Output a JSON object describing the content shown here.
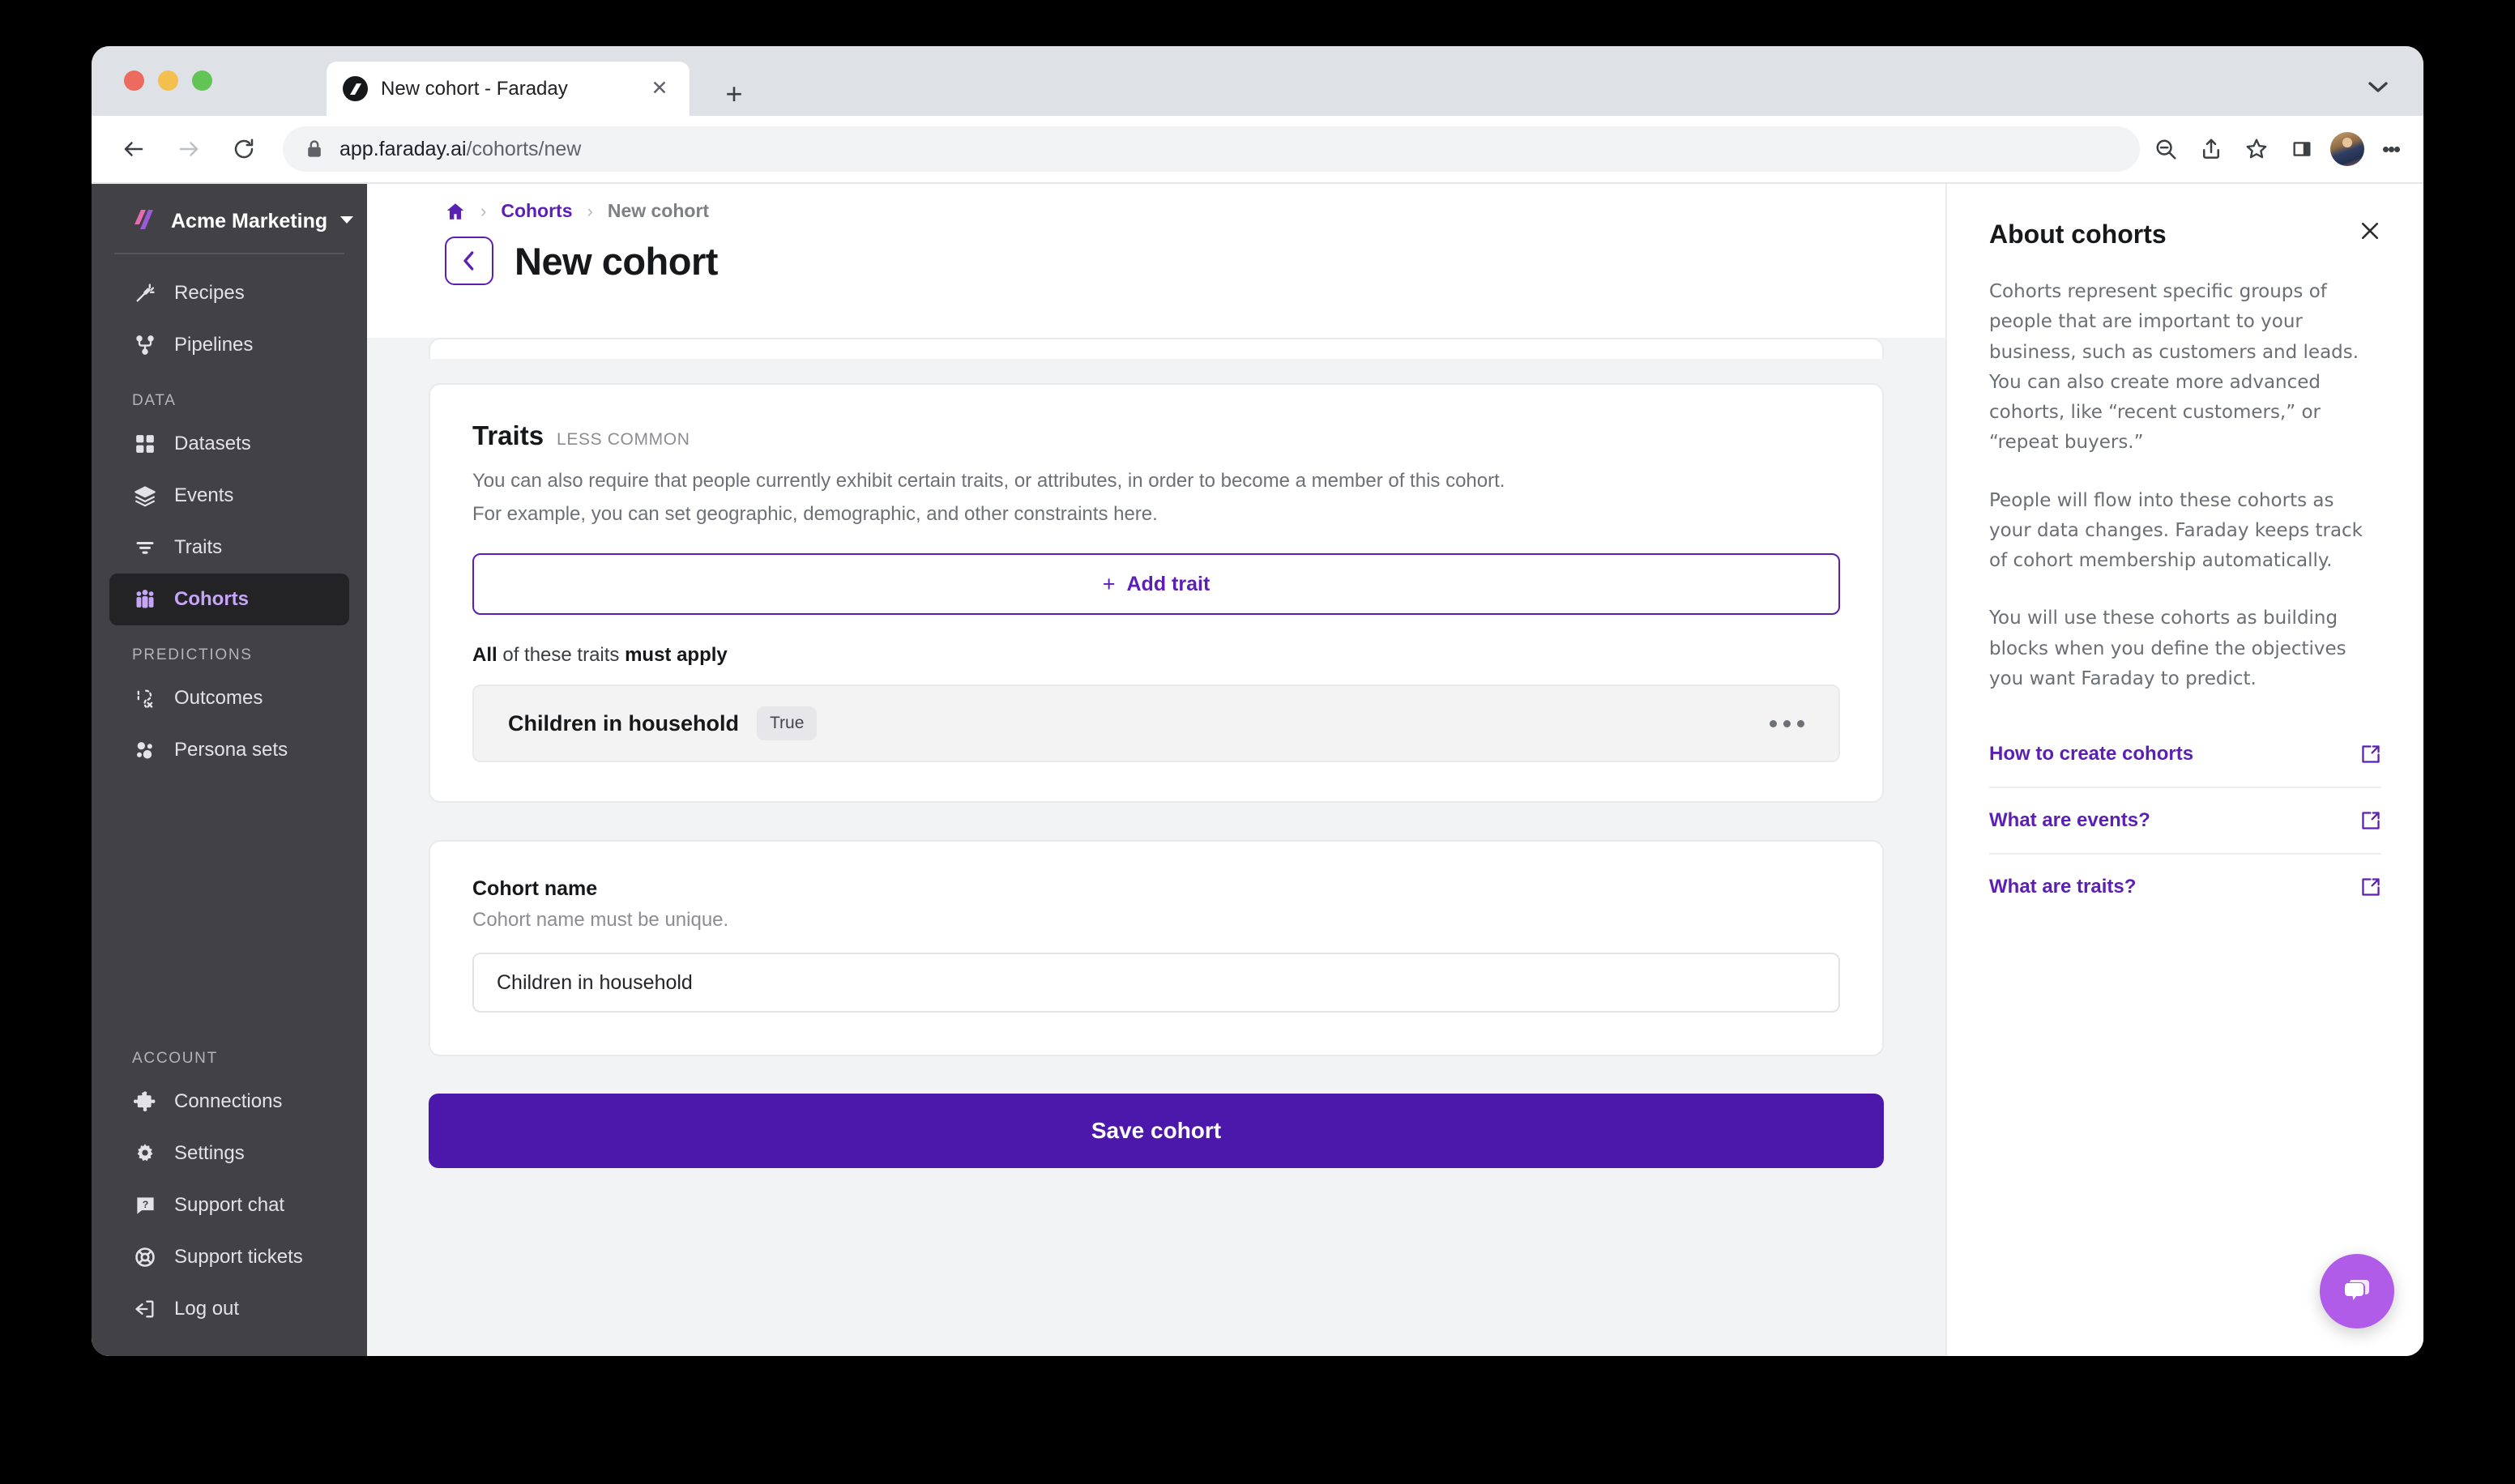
{
  "browser": {
    "tab_title": "New cohort - Faraday",
    "tab_close_glyph": "✕",
    "new_tab_glyph": "+",
    "url_host": "app.faraday.ai",
    "url_path": "/cohorts/new"
  },
  "sidebar": {
    "org_name": "Acme Marketing",
    "nav_primary": [
      {
        "label": "Recipes",
        "icon": "magic-wand-icon"
      },
      {
        "label": "Pipelines",
        "icon": "pipelines-icon"
      }
    ],
    "section_data": "DATA",
    "nav_data": [
      {
        "label": "Datasets",
        "icon": "datasets-icon"
      },
      {
        "label": "Events",
        "icon": "events-layers-icon"
      },
      {
        "label": "Traits",
        "icon": "traits-filter-icon"
      },
      {
        "label": "Cohorts",
        "icon": "cohorts-people-icon",
        "active": true
      }
    ],
    "section_predictions": "PREDICTIONS",
    "nav_predictions": [
      {
        "label": "Outcomes",
        "icon": "outcomes-icon"
      },
      {
        "label": "Persona sets",
        "icon": "persona-sets-icon"
      }
    ],
    "section_account": "ACCOUNT",
    "nav_account": [
      {
        "label": "Connections",
        "icon": "puzzle-icon"
      },
      {
        "label": "Settings",
        "icon": "gear-icon"
      },
      {
        "label": "Support chat",
        "icon": "chat-question-icon"
      },
      {
        "label": "Support tickets",
        "icon": "lifebuoy-icon"
      },
      {
        "label": "Log out",
        "icon": "logout-icon"
      }
    ]
  },
  "breadcrumb": {
    "home_icon": "home-icon",
    "separator": "›",
    "cohorts": "Cohorts",
    "current": "New cohort"
  },
  "page": {
    "title": "New cohort",
    "back_glyph": "‹"
  },
  "traits_card": {
    "title": "Traits",
    "tag": "LESS COMMON",
    "description_line1": "You can also require that people currently exhibit certain traits, or attributes, in order to become a member of this cohort.",
    "description_line2": "For example, you can set geographic, demographic, and other constraints here.",
    "add_trait_label": "Add trait",
    "add_trait_plus": "+",
    "must_apply_prefix": "All",
    "must_apply_mid": " of these traits ",
    "must_apply_suffix": "must apply",
    "rows": [
      {
        "name": "Children in household",
        "value": "True"
      }
    ]
  },
  "name_card": {
    "label": "Cohort name",
    "hint": "Cohort name must be unique.",
    "value": "Children in household",
    "placeholder": "Cohort name"
  },
  "save": {
    "label": "Save cohort"
  },
  "about": {
    "title": "About cohorts",
    "close_glyph": "✕",
    "paragraphs": [
      "Cohorts represent specific groups of people that are important to your business, such as customers and leads. You can also create more advanced cohorts, like “recent customers,” or “repeat buyers.”",
      "People will flow into these cohorts as your data changes. Faraday keeps track of cohort membership automatically.",
      "You will use these cohorts as building blocks when you define the objectives you want Faraday to predict."
    ],
    "links": [
      {
        "label": "How to create cohorts",
        "icon": "external-link-icon"
      },
      {
        "label": "What are events?",
        "icon": "external-link-icon"
      },
      {
        "label": "What are traits?",
        "icon": "external-link-icon"
      }
    ]
  },
  "chat_widget": {
    "icon": "chat-bubbles-icon"
  },
  "colors": {
    "brand_purple": "#5b1fb5",
    "save_purple": "#4c18ac",
    "active_nav_text": "#c6a5f7",
    "sidebar_bg": "#414146",
    "chat_purple": "#b05ce8"
  }
}
